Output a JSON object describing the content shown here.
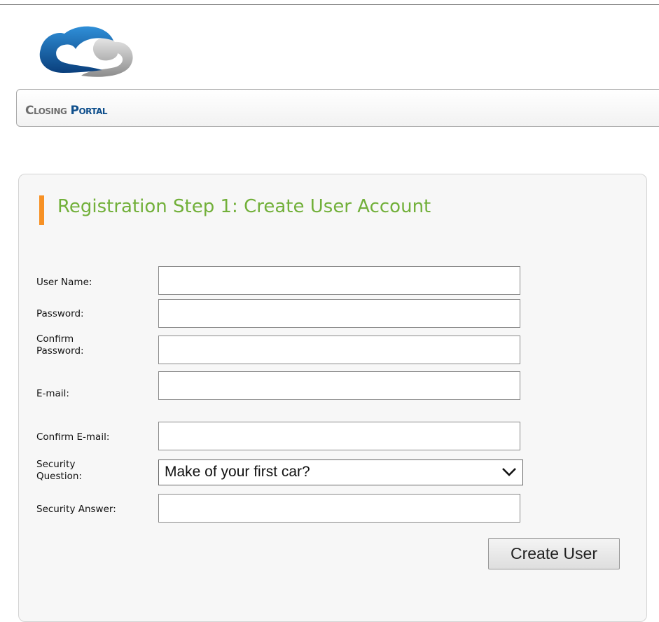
{
  "header": {
    "brand_word1": "Closing",
    "brand_word2": "Portal",
    "logo_icon": "cloud-c-logo-icon",
    "colors": {
      "brand_blue": "#0f4f8c",
      "brand_gray": "#6e6e6e"
    }
  },
  "form": {
    "title": "Registration Step 1: Create User Account",
    "accent_color": "#f79125",
    "title_color": "#72b03a",
    "fields": {
      "username": {
        "label": "User Name:",
        "value": ""
      },
      "password": {
        "label": "Password:",
        "value": ""
      },
      "confirm_password": {
        "label_line1": "Confirm",
        "label_line2": "Password:",
        "value": ""
      },
      "email": {
        "label": "E-mail:",
        "value": ""
      },
      "confirm_email": {
        "label": "Confirm E-mail:",
        "value": ""
      },
      "security_question": {
        "label_line1": "Security",
        "label_line2": "Question:",
        "selected": "Make of your first car?",
        "icon": "chevron-down-icon"
      },
      "security_answer": {
        "label": "Security Answer:",
        "value": ""
      }
    },
    "submit_label": "Create User"
  }
}
